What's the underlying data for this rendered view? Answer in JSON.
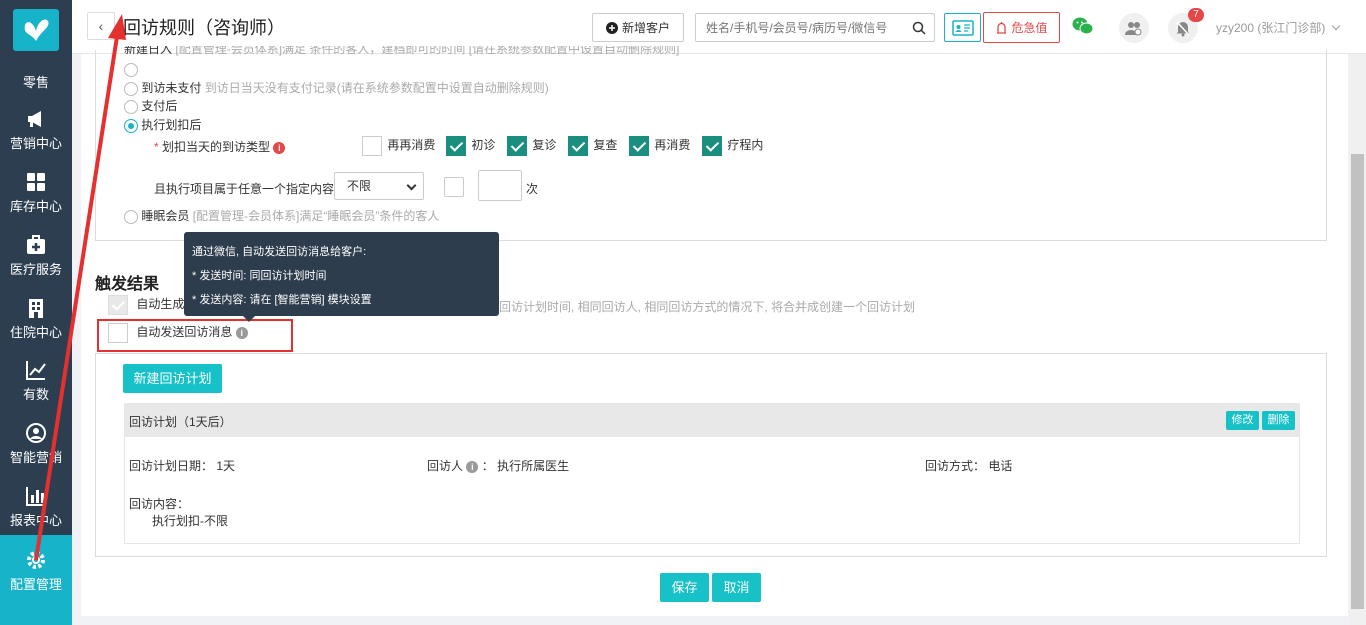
{
  "sidebar": {
    "items": [
      {
        "label": "零售",
        "icon": "cart-icon"
      },
      {
        "label": "营销中心",
        "icon": "megaphone-icon"
      },
      {
        "label": "库存中心",
        "icon": "grid-icon"
      },
      {
        "label": "医疗服务",
        "icon": "medical-kit-icon"
      },
      {
        "label": "住院中心",
        "icon": "hospital-icon"
      },
      {
        "label": "有数",
        "icon": "chart-line-icon"
      },
      {
        "label": "智能营销",
        "icon": "smart-marketing-icon"
      },
      {
        "label": "报表中心",
        "icon": "bar-chart-icon"
      },
      {
        "label": "配置管理",
        "icon": "gear-icon"
      }
    ],
    "active": "配置管理"
  },
  "header": {
    "back": "‹",
    "title": "回访规则（咨询师）",
    "new_customer": "新增客户",
    "search_placeholder": "姓名/手机号/会员号/病历号/微信号",
    "danger_label": "危急值",
    "notification_count": "7",
    "user": "yzy200 (张江门诊部)"
  },
  "rules": {
    "hidden_row": "新建日入",
    "hidden_row_hint": "[配置管理-会员体系]满足 条件的客人，建档即可的时间 [请在系统参数配置中设置自动删除规则]",
    "unpaid_label": "到访未支付",
    "unpaid_hint": "到访日当天没有支付记录(请在系统参数配置中设置自动删除规则)",
    "after_pay_label": "支付后",
    "after_deduct_label": "执行划扣后",
    "visit_type_label": "划扣当天的到访类型",
    "visit_types": [
      {
        "label": "再再消费",
        "checked": false
      },
      {
        "label": "初诊",
        "checked": true
      },
      {
        "label": "复诊",
        "checked": true
      },
      {
        "label": "复查",
        "checked": true
      },
      {
        "label": "再消费",
        "checked": true
      },
      {
        "label": "疗程内",
        "checked": true
      }
    ],
    "project_label": "且执行项目属于任意一个指定内容",
    "project_select": "不限",
    "times_unit": "次",
    "sleep_member_label": "睡眠会员",
    "sleep_member_hint": "[配置管理-会员体系]满足“睡眠会员”条件的客人"
  },
  "trigger": {
    "title": "触发结果",
    "auto_create_label": "自动生成",
    "auto_create_hint": "回访计划时间, 相同回访人, 相同回访方式的情况下, 将合并成创建一个回访计划",
    "auto_send_label": "自动发送回访消息",
    "tooltip": {
      "line1": "通过微信, 自动发送回访消息给客户:",
      "line2": "* 发送时间: 同回访计划时间",
      "line3": "* 发送内容: 请在 [智能营销] 模块设置"
    }
  },
  "plan": {
    "new_button": "新建回访计划",
    "head_title": "回访计划（1天后）",
    "edit": "修改",
    "delete": "删除",
    "date_label": "回访计划日期：",
    "date_value": "1天",
    "visitor_label": "回访人",
    "visitor_value": "执行所属医生",
    "method_label": "回访方式：",
    "method_value": "电话",
    "content_label": "回访内容：",
    "content_value": "执行划扣-不限"
  },
  "footer": {
    "save": "保存",
    "cancel": "取消"
  },
  "colors": {
    "sidebar_bg": "#2c3e50",
    "accent": "#17c1c8",
    "checkbox_on": "#1a8f7f",
    "danger": "#e54848"
  }
}
